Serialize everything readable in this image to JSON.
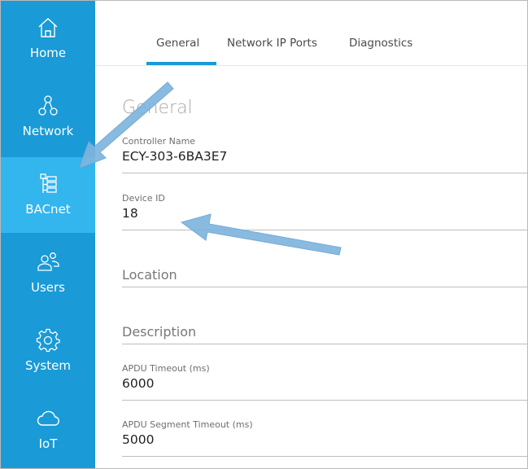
{
  "sidebar": {
    "items": [
      {
        "label": "Home",
        "icon": "home-icon"
      },
      {
        "label": "Network",
        "icon": "network-icon"
      },
      {
        "label": "BACnet",
        "icon": "bacnet-tree-icon",
        "active": true
      },
      {
        "label": "Users",
        "icon": "users-icon"
      },
      {
        "label": "System",
        "icon": "gear-icon"
      },
      {
        "label": "IoT",
        "icon": "cloud-icon"
      }
    ],
    "color": "#1a9ad6",
    "active_color": "#33b5ee"
  },
  "tabs": [
    {
      "label": "General",
      "active": true
    },
    {
      "label": "Network IP Ports"
    },
    {
      "label": "Diagnostics"
    }
  ],
  "section_title": "General",
  "fields": {
    "controller_name": {
      "label": "Controller Name",
      "value": "ECY-303-6BA3E7"
    },
    "device_id": {
      "label": "Device ID",
      "value": "18"
    },
    "location": {
      "placeholder": "Location"
    },
    "description": {
      "placeholder": "Description"
    },
    "apdu_timeout": {
      "label": "APDU Timeout (ms)",
      "value": "6000"
    },
    "apdu_segment_timeout": {
      "label": "APDU Segment Timeout (ms)",
      "value": "5000"
    }
  },
  "annotation_arrow_color": "#7fb5de"
}
